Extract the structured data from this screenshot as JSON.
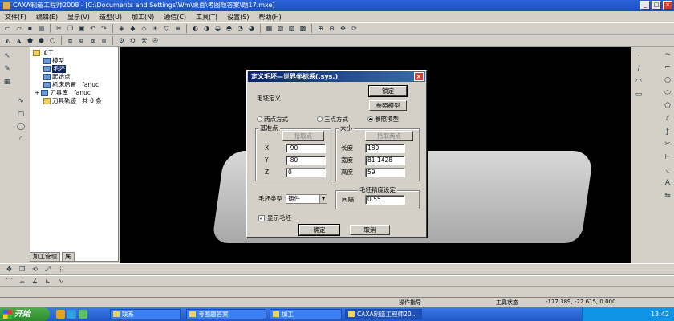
{
  "window": {
    "title": "CAXA制造工程师2008 - [C:\\Documents and Settings\\Wm\\桌面\\考图题答案\\题17.mxe]",
    "min": "_",
    "max": "□",
    "close": "×"
  },
  "menu": [
    "文件(F)",
    "编辑(E)",
    "显示(V)",
    "造型(U)",
    "加工(N)",
    "通信(C)",
    "工具(T)",
    "设置(S)",
    "帮助(H)"
  ],
  "tree": {
    "root": "加工",
    "items": [
      "模型",
      "毛坯",
      "起始点",
      "机床后置 : fanuc",
      "刀具库 : fanuc",
      "刀具轨迹 : 共 0 条"
    ],
    "selected": "毛坯"
  },
  "tabs": [
    "加工管理",
    "属"
  ],
  "dialog": {
    "title": "定义毛坯—世界坐标系(.sys.)",
    "close": "×",
    "ok_top": "锁定",
    "group_main": "毛坯定义",
    "ref_model_btn": "参照模型",
    "radios": [
      {
        "label": "两点方式",
        "on": false
      },
      {
        "label": "三点方式",
        "on": false
      },
      {
        "label": "参照模型",
        "on": true
      }
    ],
    "base_group": "基准点",
    "pick_btn": "拾取点",
    "x_label": "X",
    "x_val": "-90",
    "y_label": "Y",
    "y_val": "-80",
    "z_label": "Z",
    "z_val": "0",
    "size_group": "大小",
    "pick2_btn": "拾取两点",
    "len_label": "长度",
    "len_val": "180",
    "wid_label": "宽度",
    "wid_val": "81.1428",
    "hei_label": "高度",
    "hei_val": "59",
    "type_label": "毛坯类型",
    "type_val": "铸件",
    "prec_group": "毛坯精度设定",
    "gap_label": "间隔",
    "gap_val": "0.55",
    "show_check": "显示毛坯",
    "show_mark": "✓",
    "ok": "确定",
    "cancel": "取消"
  },
  "status": {
    "hint": "操作指导",
    "tool": "工具状态",
    "coords": "-177.389, -22.615, 0.000"
  },
  "taskbar": {
    "start": "开始",
    "tasks": [
      "联系",
      "考图题答案",
      "加工",
      "CAXA制造工程师20..."
    ],
    "clock": "13:42"
  },
  "colors": {
    "title": "#1a4fc0",
    "viewport": "#000000",
    "selection": "#0a246a",
    "taskbar": "#2258c8"
  }
}
